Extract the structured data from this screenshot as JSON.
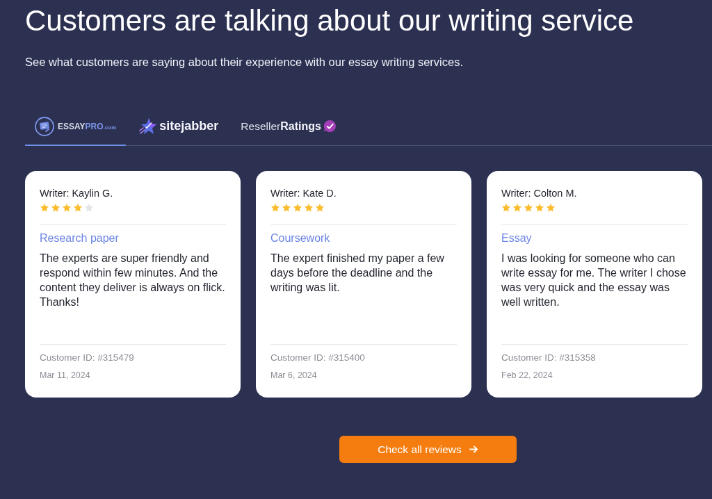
{
  "header": {
    "title": "Customers are talking about our writing service",
    "subtitle": "See what customers are saying about their experience with our essay writing services."
  },
  "tabs": [
    {
      "kind": "essaypro",
      "selected": true,
      "parts": [
        "ESSAY",
        "PRO",
        ".com"
      ]
    },
    {
      "kind": "sitejabber",
      "selected": false,
      "parts": [
        "sitejabber"
      ]
    },
    {
      "kind": "resellerratings",
      "selected": false,
      "parts": [
        "Reseller",
        "Ratings"
      ]
    }
  ],
  "cards": [
    {
      "writer": "Writer: Kaylin G.",
      "stars": 4,
      "category": "Research paper",
      "text": "The experts are super friendly and respond within few minutes. And the content they deliver is always on flick. Thanks!",
      "customer_id": "Customer ID: #315479",
      "date": "Mar 11, 2024"
    },
    {
      "writer": "Writer: Kate D.",
      "stars": 5,
      "category": "Coursework",
      "text": "The expert finished my paper a few days before the deadline and the writing was lit.",
      "customer_id": "Customer ID: #315400",
      "date": "Mar 6, 2024"
    },
    {
      "writer": "Writer: Colton M.",
      "stars": 5,
      "category": "Essay",
      "text": "I was looking for someone who can write essay for me. The writer I chose was very quick and the essay was well written.",
      "customer_id": "Customer ID: #315358",
      "date": "Feb 22, 2024"
    }
  ],
  "button": {
    "label": "Check all reviews"
  }
}
